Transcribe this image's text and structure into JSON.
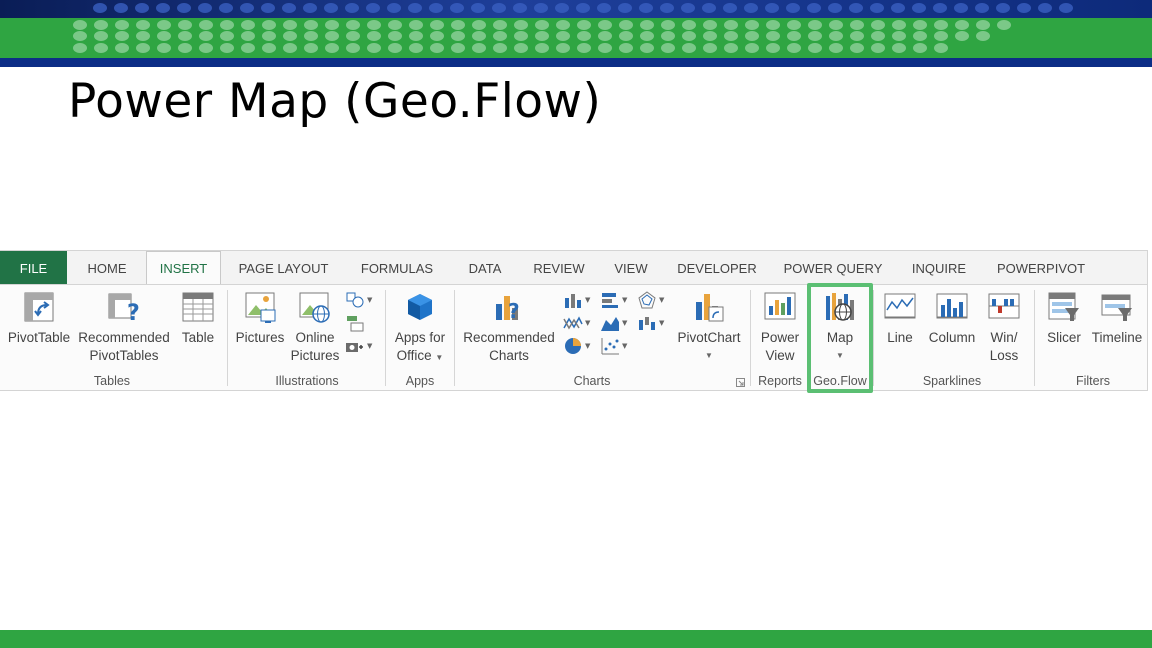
{
  "slide": {
    "title": "Power Map (Geo.Flow)",
    "colors": {
      "banner_green": "#2fa542",
      "banner_blue": "#0c2e86",
      "footer_green": "#2fa542"
    }
  },
  "ribbon": {
    "tabs": [
      {
        "label": "FILE"
      },
      {
        "label": "HOME"
      },
      {
        "label": "INSERT"
      },
      {
        "label": "PAGE LAYOUT"
      },
      {
        "label": "FORMULAS"
      },
      {
        "label": "DATA"
      },
      {
        "label": "REVIEW"
      },
      {
        "label": "VIEW"
      },
      {
        "label": "DEVELOPER"
      },
      {
        "label": "POWER QUERY"
      },
      {
        "label": "INQUIRE"
      },
      {
        "label": "POWERPIVOT"
      }
    ],
    "active_tab": "INSERT",
    "groups": {
      "tables": {
        "label": "Tables",
        "pivottable": "PivotTable",
        "recommended_pivottables_1": "Recommended",
        "recommended_pivottables_2": "PivotTables",
        "table": "Table"
      },
      "illustrations": {
        "label": "Illustrations",
        "pictures": "Pictures",
        "online_pictures_1": "Online",
        "online_pictures_2": "Pictures"
      },
      "apps": {
        "label": "Apps",
        "apps_for_office_1": "Apps for",
        "apps_for_office_2": "Office"
      },
      "charts": {
        "label": "Charts",
        "recommended_charts_1": "Recommended",
        "recommended_charts_2": "Charts",
        "pivotchart": "PivotChart"
      },
      "reports": {
        "label": "Reports",
        "power_view_1": "Power",
        "power_view_2": "View"
      },
      "geoflow": {
        "label": "Geo.Flow",
        "map": "Map"
      },
      "sparklines": {
        "label": "Sparklines",
        "line": "Line",
        "column": "Column",
        "winloss_1": "Win/",
        "winloss_2": "Loss"
      },
      "filters": {
        "label": "Filters",
        "slicer": "Slicer",
        "timeline": "Timeline"
      }
    },
    "colors": {
      "file_tab": "#217346",
      "active_tab_text": "#217346",
      "highlight": "#5bbf73",
      "icon_blue": "#2b6cb5",
      "icon_orange": "#e8a33c"
    }
  }
}
